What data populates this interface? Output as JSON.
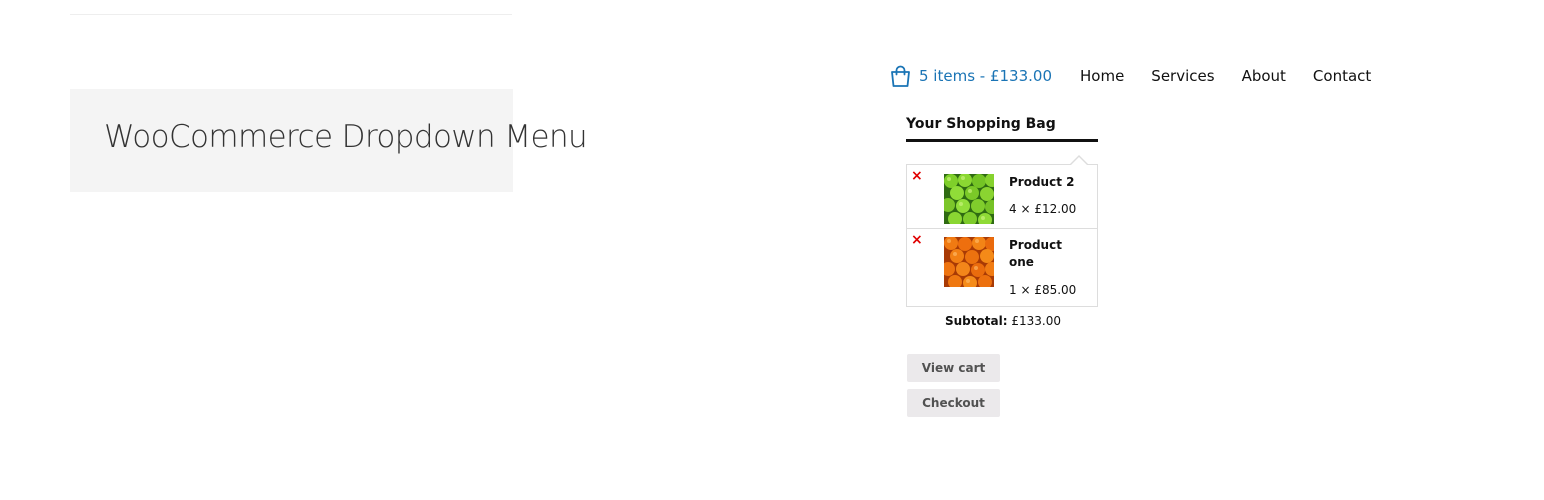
{
  "page": {
    "title": "WooCommerce Dropdown Menu"
  },
  "nav": {
    "cart_label": "5 items - £133.00",
    "items": [
      {
        "label": "Home"
      },
      {
        "label": "Services"
      },
      {
        "label": "About"
      },
      {
        "label": "Contact"
      }
    ]
  },
  "cart": {
    "heading": "Your Shopping Bag",
    "remove_symbol": "×",
    "items": [
      {
        "name": "Product 2",
        "qty_price": "4 × £12.00",
        "image": "green-apples"
      },
      {
        "name": "Product one",
        "qty_price": "1 × £85.00",
        "image": "oranges"
      }
    ],
    "subtotal_label": "Subtotal:",
    "subtotal_value": "£133.00",
    "view_cart_label": "View cart",
    "checkout_label": "Checkout"
  },
  "colors": {
    "accent": "#1a74b5",
    "remove": "#e00000",
    "button_bg": "#ebe9eb",
    "title_box_bg": "#f4f4f4"
  },
  "icons": {
    "cart": "shopping-bag-icon",
    "remove": "remove-icon"
  }
}
